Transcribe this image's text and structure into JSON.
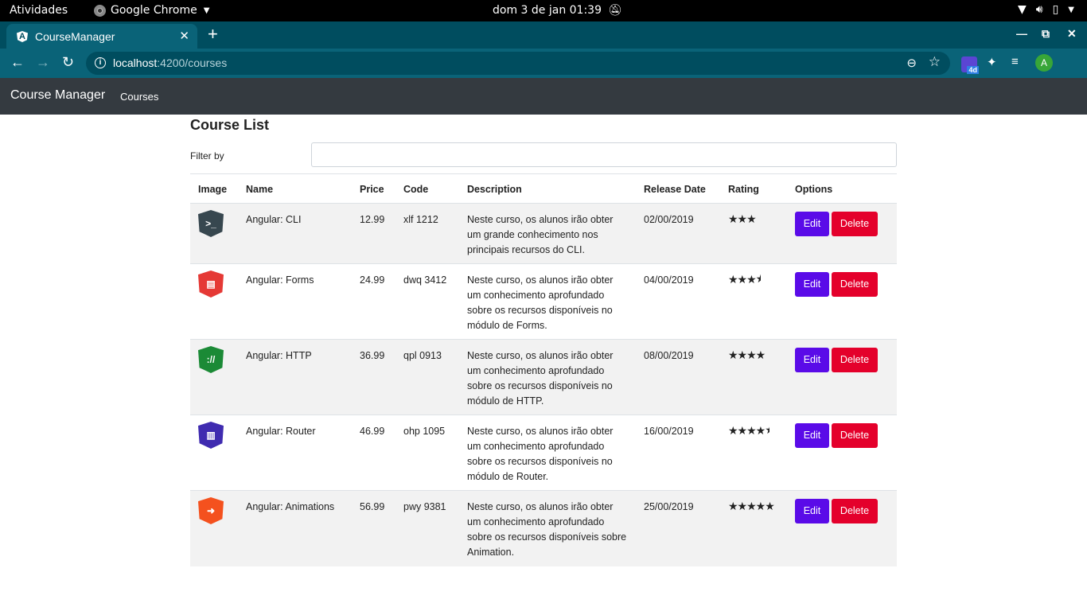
{
  "system": {
    "activities": "Atividades",
    "app_name": "Google Chrome",
    "clock": "dom 3 de jan  01:39"
  },
  "browser": {
    "tab_title": "CourseManager",
    "url_host": "localhost",
    "url_path": ":4200/courses",
    "extension_badge": "4d",
    "profile_initial": "A"
  },
  "navbar": {
    "brand": "Course Manager",
    "link_courses": "Courses"
  },
  "page": {
    "title": "Course List",
    "filter_label": "Filter by",
    "filter_value": ""
  },
  "table": {
    "headers": [
      "Image",
      "Name",
      "Price",
      "Code",
      "Description",
      "Release Date",
      "Rating",
      "Options"
    ],
    "rows": [
      {
        "name": "Angular: CLI",
        "price": "12.99",
        "code": "xlf 1212",
        "description": "Neste curso, os alunos irão obter um grande conhecimento nos principais recursos do CLI.",
        "release_date": "02/00/2019",
        "rating": 3,
        "icon": "cli-icon",
        "icon_color": "#37474f",
        "icon_glyph": ">_",
        "edit": "Edit",
        "delete": "Delete"
      },
      {
        "name": "Angular: Forms",
        "price": "24.99",
        "code": "dwq 3412",
        "description": "Neste curso, os alunos irão obter um conhecimento aprofundado sobre os recursos disponíveis no módulo de Forms.",
        "release_date": "04/00/2019",
        "rating": 3.5,
        "icon": "forms-icon",
        "icon_color": "#e53935",
        "icon_glyph": "▤",
        "edit": "Edit",
        "delete": "Delete"
      },
      {
        "name": "Angular: HTTP",
        "price": "36.99",
        "code": "qpl 0913",
        "description": "Neste curso, os alunos irão obter um conhecimento aprofundado sobre os recursos disponíveis no módulo de HTTP.",
        "release_date": "08/00/2019",
        "rating": 4,
        "icon": "http-icon",
        "icon_color": "#1b8a36",
        "icon_glyph": "://",
        "edit": "Edit",
        "delete": "Delete"
      },
      {
        "name": "Angular: Router",
        "price": "46.99",
        "code": "ohp 1095",
        "description": "Neste curso, os alunos irão obter um conhecimento aprofundado sobre os recursos disponíveis no módulo de Router.",
        "release_date": "16/00/2019",
        "rating": 4.5,
        "icon": "router-icon",
        "icon_color": "#3f2bb0",
        "icon_glyph": "▥",
        "edit": "Edit",
        "delete": "Delete"
      },
      {
        "name": "Angular: Animations",
        "price": "56.99",
        "code": "pwy 9381",
        "description": "Neste curso, os alunos irão obter um conhecimento aprofundado sobre os recursos disponíveis sobre Animation.",
        "release_date": "25/00/2019",
        "rating": 5,
        "icon": "animations-icon",
        "icon_color": "#f4511e",
        "icon_glyph": "➜",
        "edit": "Edit",
        "delete": "Delete"
      }
    ]
  }
}
